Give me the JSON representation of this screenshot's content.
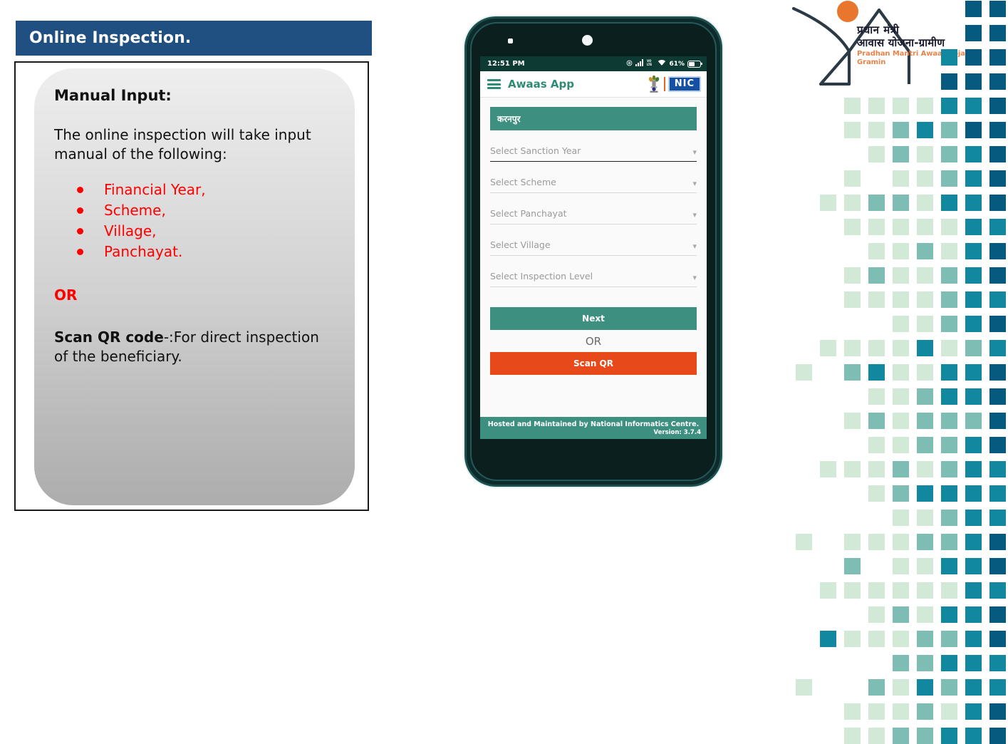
{
  "slide": {
    "title": "Online Inspection.",
    "card": {
      "heading": "Manual Input:",
      "paragraph": "The online inspection will take input manual of the following:",
      "bullets": [
        "Financial Year,",
        "Scheme,",
        "Village,",
        "Panchayat."
      ],
      "or_label": "OR",
      "qr_bold": "Scan QR code",
      "qr_rest": "-:For direct inspection of the beneficiary."
    },
    "colors": {
      "title_bar": "#1F5081",
      "bullet_red": "#FF0000",
      "card_gradient_top": "#eeeeee",
      "card_gradient_bottom": "#adadad"
    }
  },
  "phone": {
    "status_bar": {
      "time": "12:51 PM",
      "battery_percent": "61%",
      "icons": [
        "mute-icon",
        "signal-bars-icon",
        "volte-icon",
        "wifi-icon",
        "battery-icon"
      ]
    },
    "app_bar": {
      "menu_icon": "hamburger-menu-icon",
      "title": "Awaas App",
      "emblem_icon": "india-state-emblem-icon",
      "nic_label": "NIC"
    },
    "location_bar": "करनपुर",
    "fields": [
      {
        "label": "Select Sanction Year",
        "active": true
      },
      {
        "label": "Select Scheme",
        "active": false
      },
      {
        "label": "Select Panchayat",
        "active": false
      },
      {
        "label": "Select Village",
        "active": false
      },
      {
        "label": "Select Inspection Level",
        "active": false
      }
    ],
    "buttons": {
      "next": "Next",
      "or": "OR",
      "scan_qr": "Scan QR"
    },
    "footer": {
      "text": "Hosted and Maintained by National Informatics Centre.",
      "version": "Version: 3.7.4"
    },
    "colors": {
      "status_bar": "#0d3b33",
      "accent_green": "#3d9080",
      "scan_orange": "#E8491B",
      "nic_blue": "#1450A3"
    }
  },
  "branding": {
    "logo_icon": "pmay-gramin-house-logo-icon",
    "line1": "प्रधान मंत्री",
    "line2": "आवास योजना-ग्रामीण",
    "line3": "Pradhan Mantri Awaas Yojana-Gramin",
    "colors": {
      "sun": "#E8762C",
      "outline": "#2b3a44",
      "latin_text": "#E8844A"
    }
  },
  "pixel_pattern": {
    "description": "decorative teal checkerboard pixel grid along right edge",
    "cell": 23,
    "gap": 11,
    "palette": {
      "pale": "#d2e9d7",
      "mint": "#7dbdb4",
      "teal": "#1188a0",
      "deep": "#065a80",
      "navy": "#0d5c7e"
    },
    "rows": [
      [
        "",
        "",
        "",
        "",
        "",
        "",
        "",
        "deep",
        "deep"
      ],
      [
        "",
        "",
        "",
        "",
        "",
        "",
        "",
        "deep",
        "deep"
      ],
      [
        "",
        "",
        "",
        "",
        "",
        "",
        "teal",
        "deep",
        "deep"
      ],
      [
        "",
        "",
        "",
        "",
        "",
        "",
        "deep",
        "deep",
        "deep"
      ],
      [
        "",
        "",
        "pale",
        "pale",
        "pale",
        "pale",
        "teal",
        "teal",
        "deep"
      ],
      [
        "",
        "",
        "pale",
        "pale",
        "mint",
        "teal",
        "mint",
        "deep",
        "deep"
      ],
      [
        "",
        "",
        "",
        "pale",
        "mint",
        "pale",
        "mint",
        "teal",
        "deep"
      ],
      [
        "",
        "",
        "pale",
        "",
        "pale",
        "pale",
        "mint",
        "teal",
        "deep"
      ],
      [
        "",
        "pale",
        "pale",
        "mint",
        "mint",
        "pale",
        "teal",
        "teal",
        "deep"
      ],
      [
        "",
        "",
        "pale",
        "pale",
        "pale",
        "pale",
        "pale",
        "teal",
        "teal"
      ],
      [
        "",
        "",
        "",
        "pale",
        "pale",
        "mint",
        "pale",
        "teal",
        "deep"
      ],
      [
        "",
        "",
        "pale",
        "mint",
        "pale",
        "pale",
        "mint",
        "teal",
        "deep"
      ],
      [
        "",
        "",
        "pale",
        "pale",
        "pale",
        "pale",
        "mint",
        "teal",
        "teal"
      ],
      [
        "",
        "",
        "",
        "",
        "pale",
        "pale",
        "mint",
        "teal",
        "deep"
      ],
      [
        "",
        "pale",
        "pale",
        "pale",
        "pale",
        "teal",
        "pale",
        "mint",
        "teal"
      ],
      [
        "pale",
        "",
        "mint",
        "teal",
        "pale",
        "pale",
        "teal",
        "teal",
        "deep"
      ],
      [
        "",
        "",
        "",
        "pale",
        "pale",
        "mint",
        "teal",
        "teal",
        "deep"
      ],
      [
        "",
        "",
        "pale",
        "mint",
        "pale",
        "mint",
        "mint",
        "mint",
        "deep"
      ],
      [
        "",
        "",
        "",
        "pale",
        "pale",
        "mint",
        "mint",
        "teal",
        "deep"
      ],
      [
        "",
        "pale",
        "pale",
        "pale",
        "mint",
        "pale",
        "mint",
        "teal",
        "teal"
      ],
      [
        "",
        "",
        "",
        "pale",
        "mint",
        "teal",
        "teal",
        "teal",
        "teal"
      ],
      [
        "",
        "",
        "",
        "",
        "pale",
        "pale",
        "mint",
        "teal",
        "teal"
      ],
      [
        "pale",
        "",
        "pale",
        "pale",
        "pale",
        "mint",
        "mint",
        "teal",
        "deep"
      ],
      [
        "",
        "",
        "mint",
        "",
        "pale",
        "pale",
        "teal",
        "teal",
        "deep"
      ],
      [
        "",
        "pale",
        "pale",
        "pale",
        "pale",
        "pale",
        "pale",
        "teal",
        "teal"
      ],
      [
        "",
        "",
        "",
        "pale",
        "mint",
        "pale",
        "teal",
        "teal",
        "deep"
      ],
      [
        "",
        "teal",
        "pale",
        "pale",
        "pale",
        "mint",
        "mint",
        "teal",
        "deep"
      ],
      [
        "",
        "",
        "",
        "",
        "mint",
        "mint",
        "teal",
        "teal",
        "teal"
      ],
      [
        "pale",
        "",
        "",
        "mint",
        "pale",
        "teal",
        "mint",
        "teal",
        "teal"
      ],
      [
        "",
        "",
        "pale",
        "pale",
        "pale",
        "mint",
        "pale",
        "teal",
        "deep"
      ],
      [
        "",
        "",
        "pale",
        "pale",
        "mint",
        "mint",
        "teal",
        "teal",
        "deep"
      ]
    ]
  }
}
